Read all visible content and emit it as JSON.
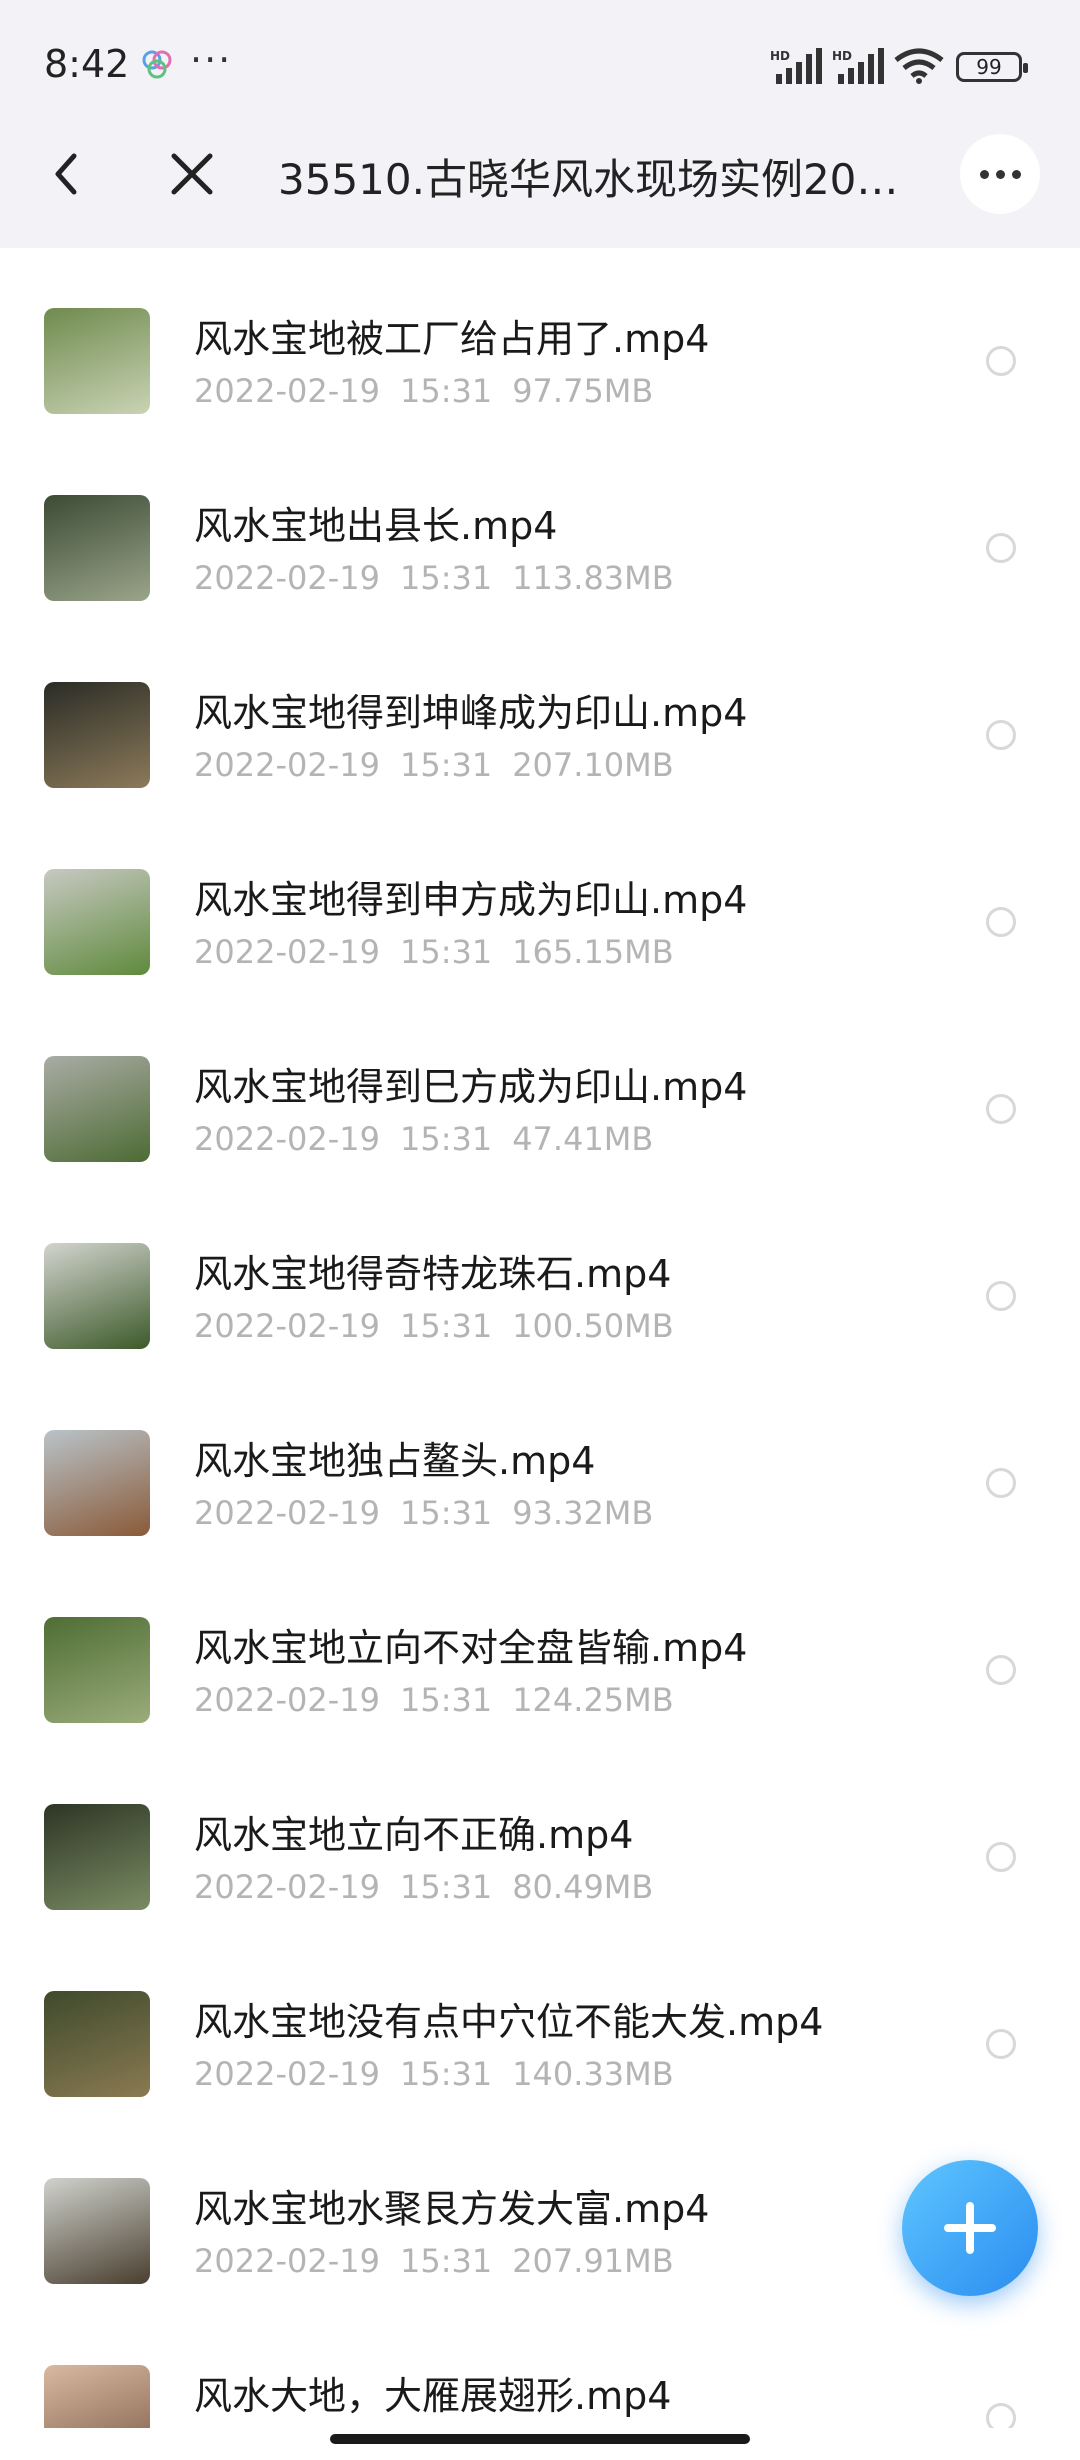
{
  "status_bar": {
    "time": "8:42",
    "battery": "99",
    "signal_labels": [
      "HD",
      "HD"
    ]
  },
  "header": {
    "title": "35510.古晓华风水现场实例20…"
  },
  "files": [
    {
      "name": "风水宝地被工厂给占用了.mp4",
      "date": "2022-02-19",
      "time": "15:31",
      "size": "97.75MB",
      "thumb_colors": [
        "#6f8a4e",
        "#c9d3b4"
      ]
    },
    {
      "name": "风水宝地出县长.mp4",
      "date": "2022-02-19",
      "time": "15:31",
      "size": "113.83MB",
      "thumb_colors": [
        "#3c4a35",
        "#9aa58a"
      ]
    },
    {
      "name": "风水宝地得到坤峰成为印山.mp4",
      "date": "2022-02-19",
      "time": "15:31",
      "size": "207.10MB",
      "thumb_colors": [
        "#2a2c26",
        "#8c7a5a"
      ]
    },
    {
      "name": "风水宝地得到申方成为印山.mp4",
      "date": "2022-02-19",
      "time": "15:31",
      "size": "165.15MB",
      "thumb_colors": [
        "#c7c9c2",
        "#5f8a3c"
      ]
    },
    {
      "name": "风水宝地得到巳方成为印山.mp4",
      "date": "2022-02-19",
      "time": "15:31",
      "size": "47.41MB",
      "thumb_colors": [
        "#a9aca4",
        "#4d6b34"
      ]
    },
    {
      "name": "风水宝地得奇特龙珠石.mp4",
      "date": "2022-02-19",
      "time": "15:31",
      "size": "100.50MB",
      "thumb_colors": [
        "#d2d4ce",
        "#3d5a2a"
      ]
    },
    {
      "name": "风水宝地独占鳌头.mp4",
      "date": "2022-02-19",
      "time": "15:31",
      "size": "93.32MB",
      "thumb_colors": [
        "#b9c3c9",
        "#8a5a38"
      ]
    },
    {
      "name": "风水宝地立向不对全盘皆输.mp4",
      "date": "2022-02-19",
      "time": "15:31",
      "size": "124.25MB",
      "thumb_colors": [
        "#4f6d35",
        "#9aac7a"
      ]
    },
    {
      "name": "风水宝地立向不正确.mp4",
      "date": "2022-02-19",
      "time": "15:31",
      "size": "80.49MB",
      "thumb_colors": [
        "#2d3525",
        "#7a8c63"
      ]
    },
    {
      "name": "风水宝地没有点中穴位不能大发.mp4",
      "date": "2022-02-19",
      "time": "15:31",
      "size": "140.33MB",
      "thumb_colors": [
        "#3e4a2c",
        "#8a7a52"
      ]
    },
    {
      "name": "风水宝地水聚艮方发大富.mp4",
      "date": "2022-02-19",
      "time": "15:31",
      "size": "207.91MB",
      "thumb_colors": [
        "#cfd2cc",
        "#4a3f30"
      ]
    },
    {
      "name": "风水大地，大雁展翅形.mp4",
      "date": "",
      "time": "",
      "size": "",
      "thumb_colors": [
        "#d9b9a0",
        "#7a5a46"
      ]
    }
  ],
  "colors": {
    "header_bg": "#f2f2f7",
    "meta_text": "#b4b4b4",
    "fab_blue": "#2a8cf0"
  }
}
